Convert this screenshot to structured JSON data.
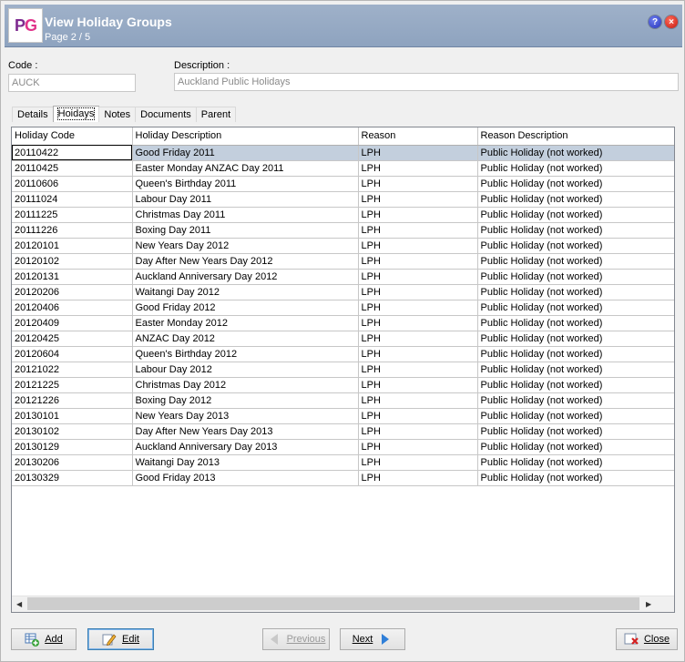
{
  "window": {
    "title": "View Holiday Groups",
    "subtitle": "Page 2 / 5",
    "logo": "PG",
    "help_icon": "?",
    "close_icon": "×"
  },
  "fields": {
    "code_label": "Code :",
    "code_value": "AUCK",
    "description_label": "Description :",
    "description_value": "Auckland Public Holidays"
  },
  "tabs": [
    {
      "label": "Details"
    },
    {
      "label": "Hoidays"
    },
    {
      "label": "Notes"
    },
    {
      "label": "Documents"
    },
    {
      "label": "Parent"
    }
  ],
  "grid": {
    "columns": [
      "Holiday Code",
      "Holiday Description",
      "Reason",
      "Reason Description"
    ],
    "rows": [
      [
        "20110422",
        "Good Friday 2011",
        "LPH",
        "Public Holiday (not worked)"
      ],
      [
        "20110425",
        "Easter Monday ANZAC Day 2011",
        "LPH",
        "Public Holiday (not worked)"
      ],
      [
        "20110606",
        "Queen's Birthday 2011",
        "LPH",
        "Public Holiday (not worked)"
      ],
      [
        "20111024",
        "Labour Day 2011",
        "LPH",
        "Public Holiday (not worked)"
      ],
      [
        "20111225",
        "Christmas Day 2011",
        "LPH",
        "Public Holiday (not worked)"
      ],
      [
        "20111226",
        "Boxing Day 2011",
        "LPH",
        "Public Holiday (not worked)"
      ],
      [
        "20120101",
        "New Years Day 2012",
        "LPH",
        "Public Holiday (not worked)"
      ],
      [
        "20120102",
        "Day After New Years Day 2012",
        "LPH",
        "Public Holiday (not worked)"
      ],
      [
        "20120131",
        "Auckland Anniversary Day 2012",
        "LPH",
        "Public Holiday (not worked)"
      ],
      [
        "20120206",
        "Waitangi Day 2012",
        "LPH",
        "Public Holiday (not worked)"
      ],
      [
        "20120406",
        "Good Friday 2012",
        "LPH",
        "Public Holiday (not worked)"
      ],
      [
        "20120409",
        "Easter Monday 2012",
        "LPH",
        "Public Holiday (not worked)"
      ],
      [
        "20120425",
        "ANZAC Day 2012",
        "LPH",
        "Public Holiday (not worked)"
      ],
      [
        "20120604",
        "Queen's Birthday 2012",
        "LPH",
        "Public Holiday (not worked)"
      ],
      [
        "20121022",
        "Labour Day 2012",
        "LPH",
        "Public Holiday (not worked)"
      ],
      [
        "20121225",
        "Christmas Day 2012",
        "LPH",
        "Public Holiday (not worked)"
      ],
      [
        "20121226",
        "Boxing Day 2012",
        "LPH",
        "Public Holiday (not worked)"
      ],
      [
        "20130101",
        "New Years Day 2013",
        "LPH",
        "Public Holiday (not worked)"
      ],
      [
        "20130102",
        "Day After New Years Day 2013",
        "LPH",
        "Public Holiday (not worked)"
      ],
      [
        "20130129",
        "Auckland Anniversary Day 2013",
        "LPH",
        "Public Holiday (not worked)"
      ],
      [
        "20130206",
        "Waitangi Day 2013",
        "LPH",
        "Public Holiday (not worked)"
      ],
      [
        "20130329",
        "Good Friday 2013",
        "LPH",
        "Public Holiday (not worked)"
      ]
    ]
  },
  "buttons": {
    "add": "Add",
    "edit": "Edit",
    "previous": "Previous",
    "next": "Next",
    "close": "Close"
  },
  "icons": {
    "add": "add-table-icon",
    "edit": "edit-pencil-icon",
    "previous": "arrow-left-icon",
    "next": "arrow-right-icon",
    "close": "close-window-icon"
  },
  "colors": {
    "header": "#9aadc6",
    "selected_row": "#c3cfdd",
    "accent_blue": "#2f7fd8"
  }
}
